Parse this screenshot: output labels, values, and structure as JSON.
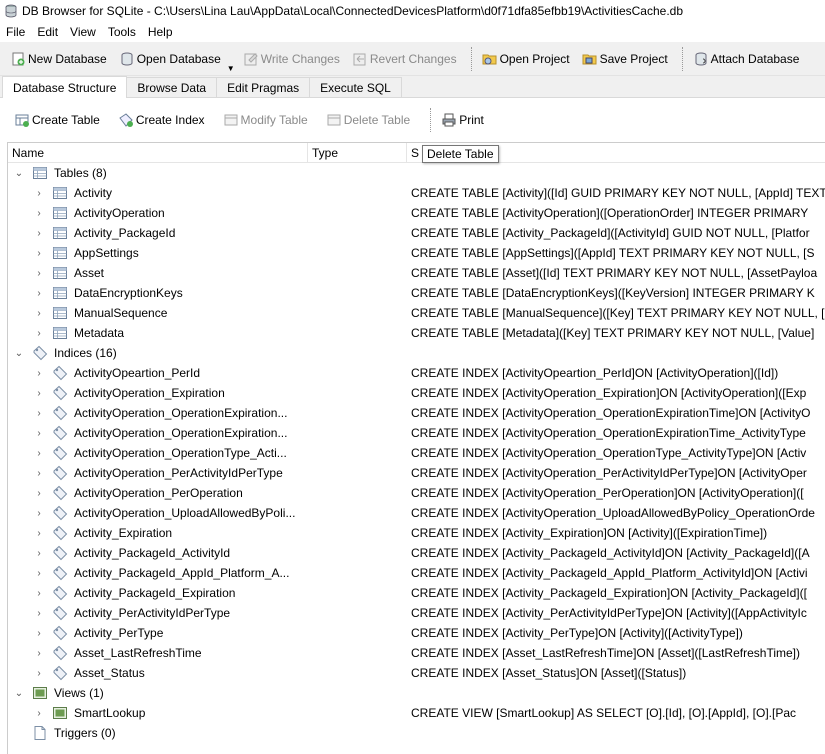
{
  "window": {
    "title": "DB Browser for SQLite - C:\\Users\\Lina Lau\\AppData\\Local\\ConnectedDevicesPlatform\\d0f71dfa85efbb19\\ActivitiesCache.db"
  },
  "menu": [
    "File",
    "Edit",
    "View",
    "Tools",
    "Help"
  ],
  "toolbar": {
    "new_database": "New Database",
    "open_database": "Open Database",
    "write_changes": "Write Changes",
    "revert_changes": "Revert Changes",
    "open_project": "Open Project",
    "save_project": "Save Project",
    "attach_database": "Attach Database"
  },
  "tabs": [
    "Database Structure",
    "Browse Data",
    "Edit Pragmas",
    "Execute SQL"
  ],
  "structure_toolbar": {
    "create_table": "Create Table",
    "create_index": "Create Index",
    "modify_table": "Modify Table",
    "delete_table": "Delete Table",
    "print": "Print"
  },
  "tooltip": "Delete Table",
  "columns": {
    "name": "Name",
    "type": "Type",
    "schema": "S"
  },
  "groups": {
    "tables": {
      "label": "Tables (8)",
      "items": [
        {
          "name": "Activity",
          "schema": "CREATE TABLE [Activity]([Id] GUID PRIMARY KEY NOT NULL, [AppId] TEXT"
        },
        {
          "name": "ActivityOperation",
          "schema": "CREATE TABLE [ActivityOperation]([OperationOrder] INTEGER PRIMARY"
        },
        {
          "name": "Activity_PackageId",
          "schema": "CREATE TABLE [Activity_PackageId]([ActivityId] GUID NOT NULL, [Platfor"
        },
        {
          "name": "AppSettings",
          "schema": "CREATE TABLE [AppSettings]([AppId] TEXT PRIMARY KEY NOT NULL, [S"
        },
        {
          "name": "Asset",
          "schema": "CREATE TABLE [Asset]([Id] TEXT PRIMARY KEY NOT NULL, [AssetPayloa"
        },
        {
          "name": "DataEncryptionKeys",
          "schema": "CREATE TABLE [DataEncryptionKeys]([KeyVersion] INTEGER PRIMARY K"
        },
        {
          "name": "ManualSequence",
          "schema": "CREATE TABLE [ManualSequence]([Key] TEXT PRIMARY KEY NOT NULL, ["
        },
        {
          "name": "Metadata",
          "schema": "CREATE TABLE [Metadata]([Key] TEXT PRIMARY KEY NOT NULL, [Value] "
        }
      ]
    },
    "indices": {
      "label": "Indices (16)",
      "items": [
        {
          "name": "ActivityOpeartion_PerId",
          "schema": "CREATE INDEX [ActivityOpeartion_PerId]ON [ActivityOperation]([Id])"
        },
        {
          "name": "ActivityOperation_Expiration",
          "schema": "CREATE INDEX [ActivityOperation_Expiration]ON [ActivityOperation]([Exp"
        },
        {
          "name": "ActivityOperation_OperationExpiration...",
          "schema": "CREATE INDEX [ActivityOperation_OperationExpirationTime]ON [ActivityO"
        },
        {
          "name": "ActivityOperation_OperationExpiration...",
          "schema": "CREATE INDEX [ActivityOperation_OperationExpirationTime_ActivityType"
        },
        {
          "name": "ActivityOperation_OperationType_Acti...",
          "schema": "CREATE INDEX [ActivityOperation_OperationType_ActivityType]ON [Activ"
        },
        {
          "name": "ActivityOperation_PerActivityIdPerType",
          "schema": "CREATE INDEX [ActivityOperation_PerActivityIdPerType]ON [ActivityOper"
        },
        {
          "name": "ActivityOperation_PerOperation",
          "schema": "CREATE INDEX [ActivityOperation_PerOperation]ON [ActivityOperation](["
        },
        {
          "name": "ActivityOperation_UploadAllowedByPoli...",
          "schema": "CREATE INDEX [ActivityOperation_UploadAllowedByPolicy_OperationOrde"
        },
        {
          "name": "Activity_Expiration",
          "schema": "CREATE INDEX [Activity_Expiration]ON [Activity]([ExpirationTime])"
        },
        {
          "name": "Activity_PackageId_ActivityId",
          "schema": "CREATE INDEX [Activity_PackageId_ActivityId]ON [Activity_PackageId]([A"
        },
        {
          "name": "Activity_PackageId_AppId_Platform_A...",
          "schema": "CREATE INDEX [Activity_PackageId_AppId_Platform_ActivityId]ON [Activi"
        },
        {
          "name": "Activity_PackageId_Expiration",
          "schema": "CREATE INDEX [Activity_PackageId_Expiration]ON [Activity_PackageId](["
        },
        {
          "name": "Activity_PerActivityIdPerType",
          "schema": "CREATE INDEX [Activity_PerActivityIdPerType]ON [Activity]([AppActivityIc"
        },
        {
          "name": "Activity_PerType",
          "schema": "CREATE INDEX [Activity_PerType]ON [Activity]([ActivityType])"
        },
        {
          "name": "Asset_LastRefreshTime",
          "schema": "CREATE INDEX [Asset_LastRefreshTime]ON [Asset]([LastRefreshTime])"
        },
        {
          "name": "Asset_Status",
          "schema": "CREATE INDEX [Asset_Status]ON [Asset]([Status])"
        }
      ]
    },
    "views": {
      "label": "Views (1)",
      "items": [
        {
          "name": "SmartLookup",
          "schema": "CREATE VIEW [SmartLookup] AS SELECT [O].[Id], [O].[AppId], [O].[Pac"
        }
      ]
    },
    "triggers": {
      "label": "Triggers (0)",
      "items": []
    }
  }
}
